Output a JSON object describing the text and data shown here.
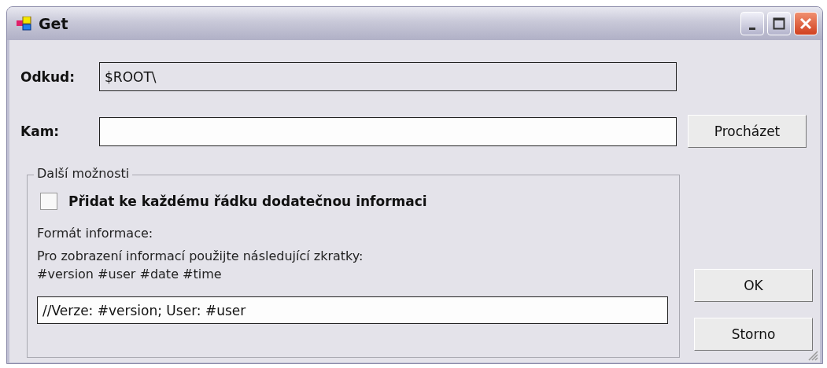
{
  "window": {
    "title": "Get"
  },
  "source": {
    "label": "Odkud:",
    "value": "$ROOT\\",
    "readonly": true
  },
  "target": {
    "label": "Kam:",
    "readonly": false
  },
  "browse_button": "Procházet",
  "options": {
    "title": "Další možnosti",
    "checkbox": {
      "label": "Přidat ke každému řádku dodatečnou informaci",
      "checked": false
    },
    "format_label": "Formát informace:",
    "hint_lines": [
      "Pro zobrazení informací použijte následující zkratky:",
      "#version #user #date #time"
    ],
    "format_value": "//Verze: #version; User: #user"
  },
  "buttons": [
    "OK",
    "Storno"
  ]
}
